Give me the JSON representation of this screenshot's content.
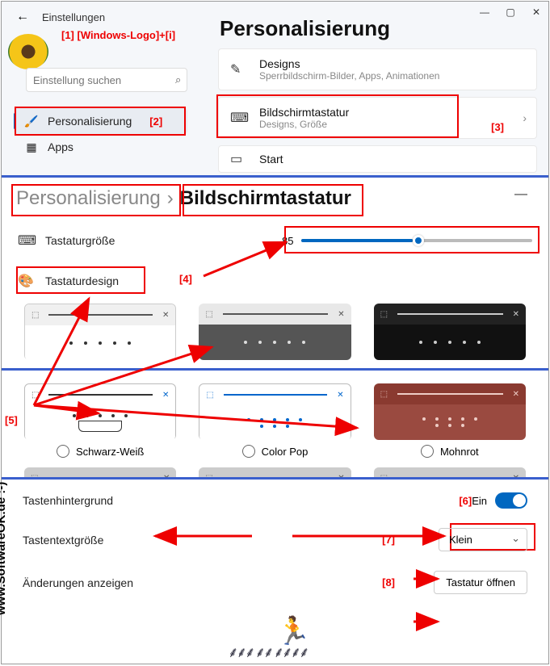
{
  "header": {
    "back_label": "←",
    "settings_label": "Einstellungen",
    "page_title": "Personalisierung"
  },
  "annotations": {
    "a1": "[1] [Windows-Logo]+[i]",
    "a2": "[2]",
    "a3": "[3]",
    "a4": "[4]",
    "a5": "[5]",
    "a6": "[6]",
    "a7": "[7]",
    "a8": "[8]"
  },
  "search": {
    "placeholder": "Einstellung suchen"
  },
  "nav": {
    "items": [
      {
        "label": "Personalisierung",
        "icon": "🖌️"
      },
      {
        "label": "Apps",
        "icon": "▦"
      }
    ]
  },
  "tiles": {
    "designs": {
      "title": "Designs",
      "sub": "Sperrbildschirm-Bilder, Apps, Animationen",
      "icon": "✎"
    },
    "keyboard": {
      "title": "Bildschirmtastatur",
      "sub": "Designs, Größe",
      "icon": "⌨"
    },
    "start": {
      "title": "Start",
      "icon": "▭"
    }
  },
  "breadcrumb": {
    "parent": "Personalisierung",
    "sep": "›",
    "current": "Bildschirmtastatur"
  },
  "size_row": {
    "icon": "⌨",
    "label": "Tastaturgröße",
    "value": "85"
  },
  "design_row": {
    "icon": "🎨",
    "label": "Tastaturdesign"
  },
  "themes": {
    "bw": "Schwarz-Weiß",
    "colorpop": "Color Pop",
    "mohnrot": "Mohnrot"
  },
  "bottom": {
    "keybg_label": "Tastenhintergrund",
    "keybg_state": "Ein",
    "textsize_label": "Tastentextgröße",
    "textsize_value": "Klein",
    "preview_label": "Änderungen anzeigen",
    "open_btn": "Tastatur öffnen"
  },
  "watermark": "www.SoftwareOK.de  :-)"
}
